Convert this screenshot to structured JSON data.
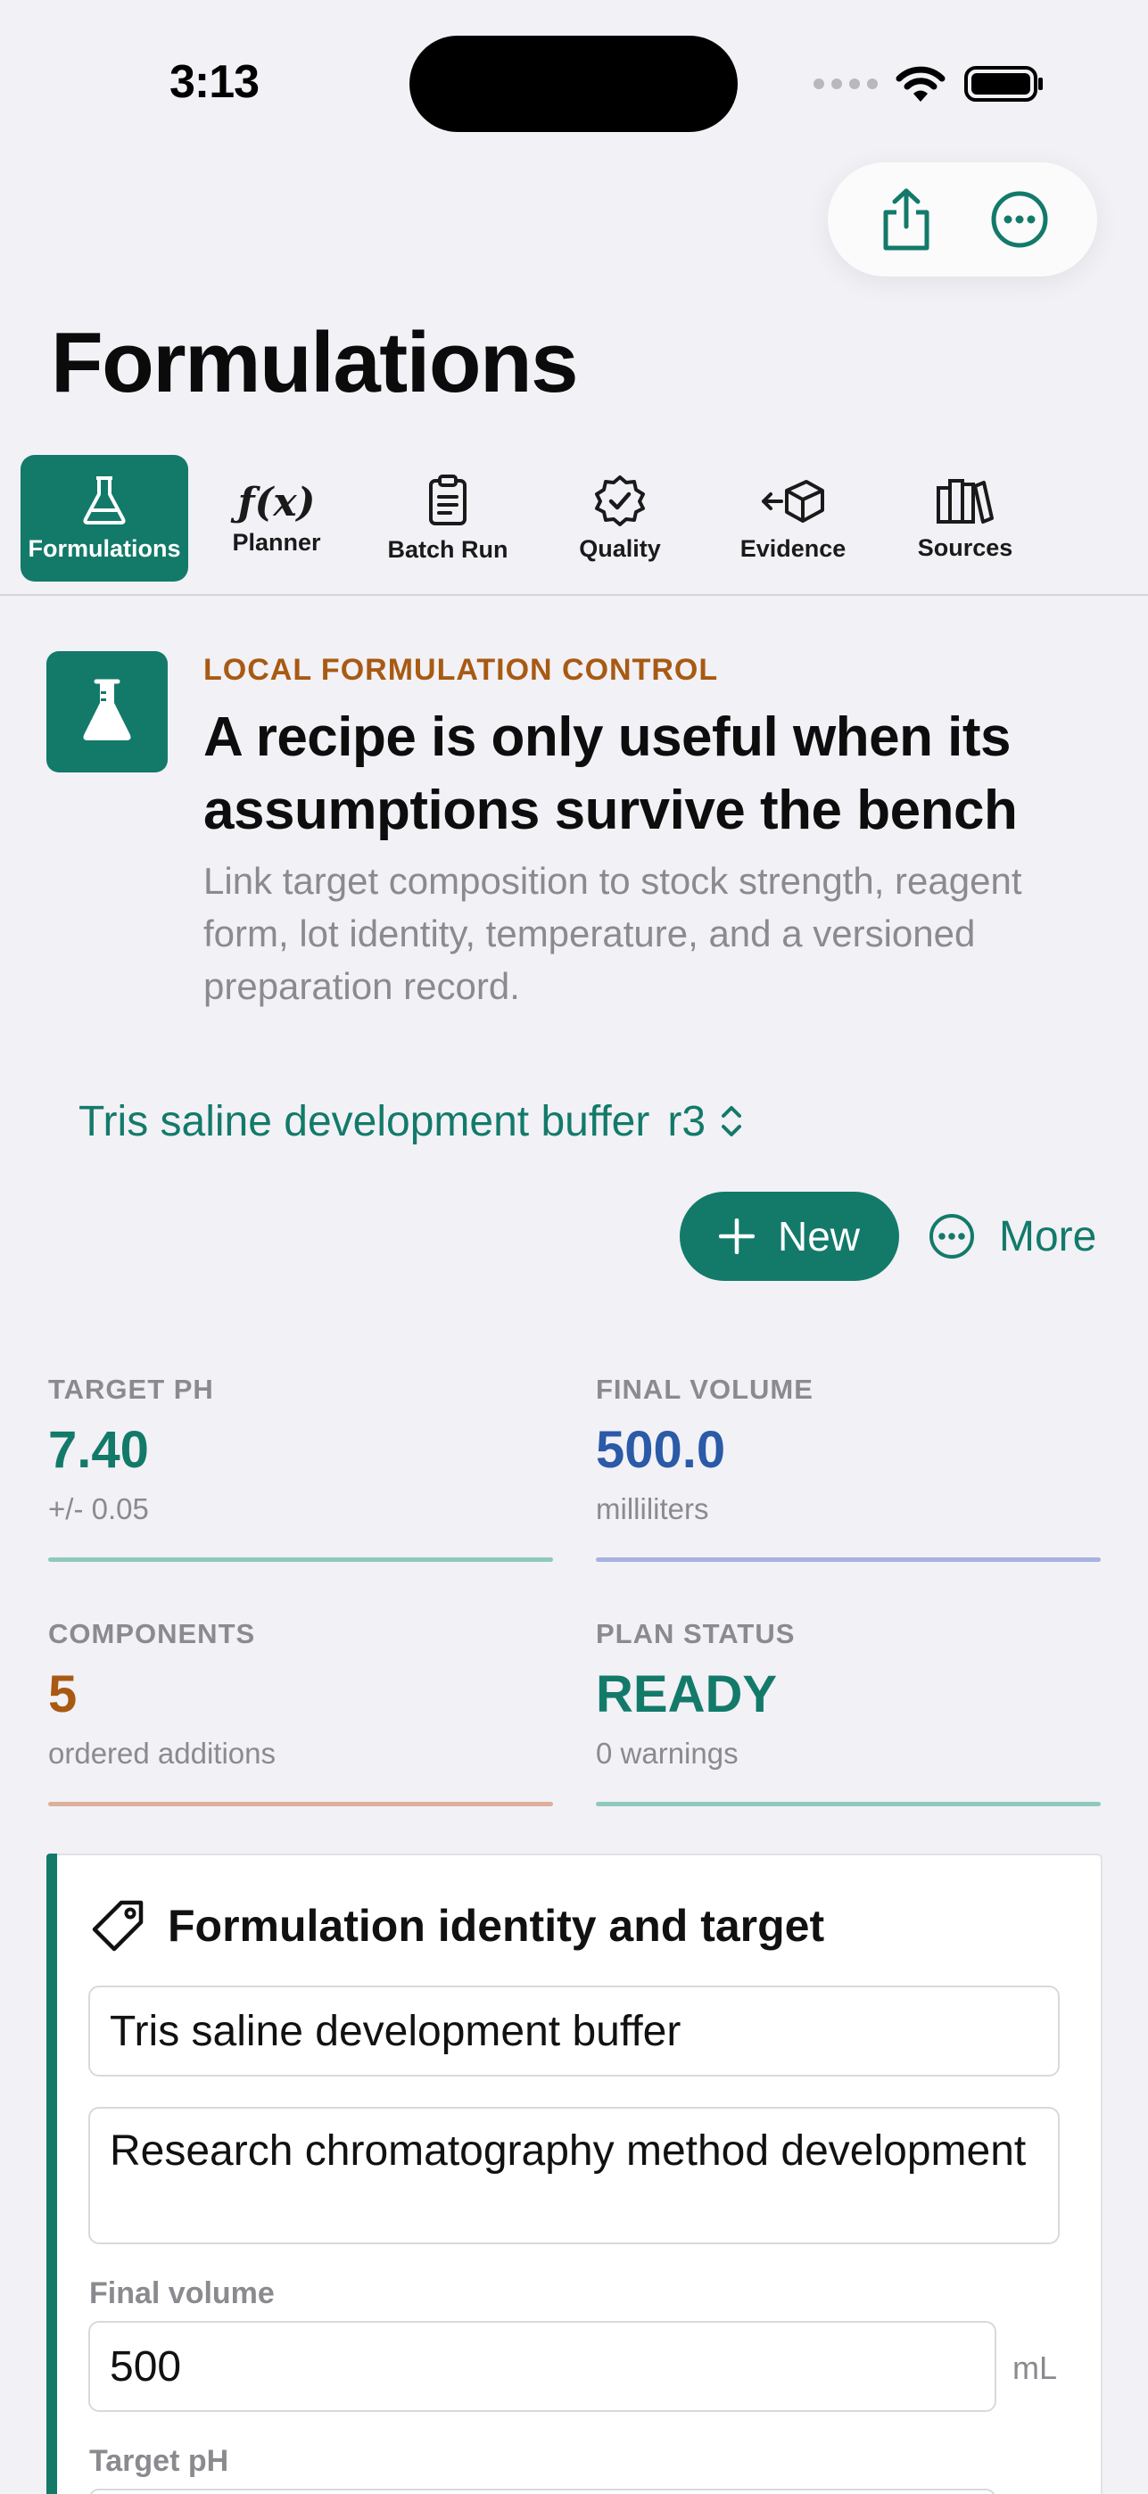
{
  "status_bar": {
    "time": "3:13"
  },
  "header": {
    "title": "Formulations"
  },
  "tabs": [
    {
      "label": "Formulations",
      "icon": "flask-icon",
      "active": true
    },
    {
      "label": "Planner",
      "icon": "function-icon",
      "active": false
    },
    {
      "label": "Batch Run",
      "icon": "clipboard-icon",
      "active": false
    },
    {
      "label": "Quality",
      "icon": "seal-check-icon",
      "active": false
    },
    {
      "label": "Evidence",
      "icon": "box-arrow-icon",
      "active": false
    },
    {
      "label": "Sources",
      "icon": "books-icon",
      "active": false
    }
  ],
  "hero": {
    "eyebrow": "LOCAL FORMULATION CONTROL",
    "heading": "A recipe is only useful when its assumptions survive the bench",
    "body": "Link target composition to stock strength, reagent form, lot identity, temperature, and a versioned preparation record."
  },
  "selector": {
    "name": "Tris saline development buffer",
    "revision": "r3"
  },
  "actions": {
    "new_label": "New",
    "more_label": "More"
  },
  "stats": [
    {
      "label": "TARGET PH",
      "value": "7.40",
      "sub": "+/- 0.05",
      "color": "#137a6a",
      "bar_color": "#8fc9bd"
    },
    {
      "label": "FINAL VOLUME",
      "value": "500.0",
      "sub": "milliliters",
      "color": "#2a5aa8",
      "bar_color": "#a6b2e0"
    },
    {
      "label": "COMPONENTS",
      "value": "5",
      "sub": "ordered additions",
      "color": "#a85a12",
      "bar_color": "#dcb09a"
    },
    {
      "label": "PLAN STATUS",
      "value": "READY",
      "sub": "0 warnings",
      "color": "#137a6a",
      "bar_color": "#8fc9bd"
    }
  ],
  "identity_card": {
    "title": "Formulation identity and target",
    "name_value": "Tris saline development buffer",
    "purpose_value": "Research chromatography method development",
    "final_volume_label": "Final volume",
    "final_volume_value": "500",
    "final_volume_unit": "mL",
    "target_ph_label": "Target pH"
  },
  "colors": {
    "accent": "#137a6a",
    "eyebrow": "#a85a12",
    "background": "#f2f1f6"
  }
}
